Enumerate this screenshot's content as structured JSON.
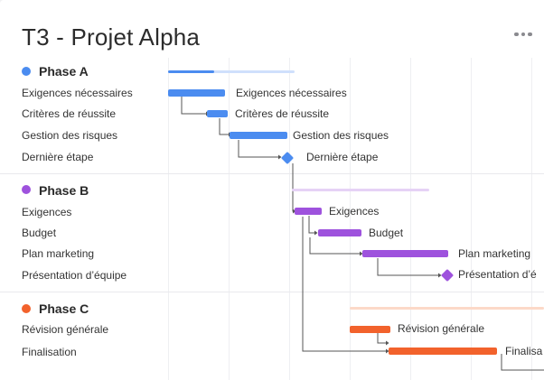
{
  "project": {
    "title": "T3 - Projet Alpha"
  },
  "menu": {
    "icon": "more-horizontal-icon"
  },
  "colors": {
    "phase_a": "#4b8cf0",
    "phase_a_light": "#cfe0fc",
    "phase_b": "#9e52dd",
    "phase_b_light": "#e6d2f6",
    "phase_c": "#f2622c",
    "phase_c_light": "#fcd9c8"
  },
  "phases": {
    "a": {
      "name": "Phase A",
      "tasks": [
        {
          "label": "Exigences nécessaires",
          "bar_label": "Exigences nécessaires"
        },
        {
          "label": "Critères de réussite",
          "bar_label": "Critères de réussite"
        },
        {
          "label": "Gestion des risques",
          "bar_label": "Gestion des risques"
        },
        {
          "label": "Dernière étape",
          "bar_label": "Dernière étape"
        }
      ]
    },
    "b": {
      "name": "Phase B",
      "tasks": [
        {
          "label": "Exigences",
          "bar_label": "Exigences"
        },
        {
          "label": "Budget",
          "bar_label": "Budget"
        },
        {
          "label": "Plan marketing",
          "bar_label": "Plan marketing"
        },
        {
          "label": "Présentation d’équipe",
          "bar_label": "Présentation d’é"
        }
      ]
    },
    "c": {
      "name": "Phase C",
      "tasks": [
        {
          "label": "Révision générale",
          "bar_label": "Révision générale"
        },
        {
          "label": "Finalisation",
          "bar_label": "Finalisa"
        }
      ]
    }
  }
}
